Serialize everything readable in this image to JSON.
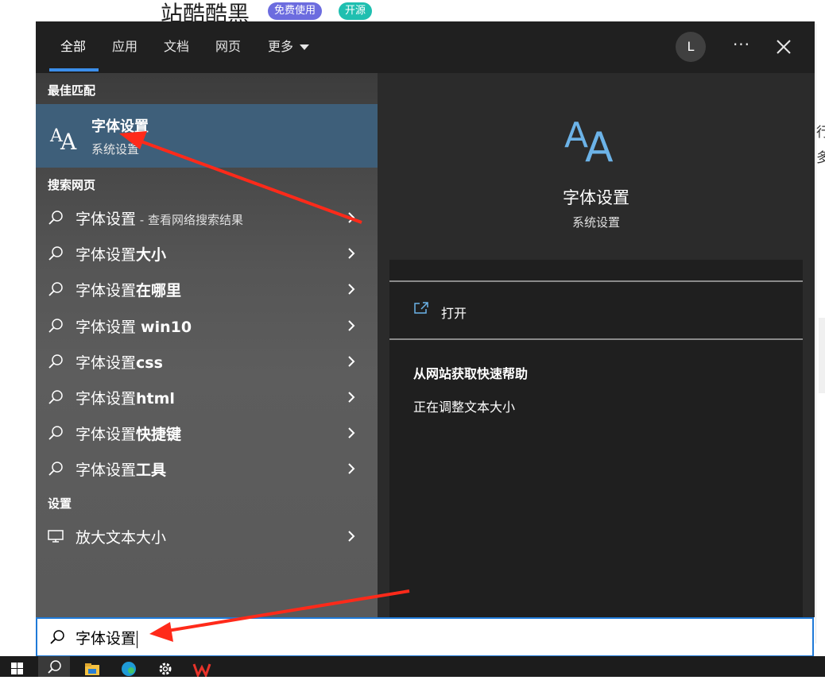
{
  "background_page": {
    "title": "站酷酷黑",
    "badge_free": "免费使用",
    "badge_open": "开源",
    "side_fragment_1": "行",
    "side_fragment_2": "多"
  },
  "tabs": [
    {
      "label": "全部",
      "active": true
    },
    {
      "label": "应用"
    },
    {
      "label": "文档"
    },
    {
      "label": "网页"
    },
    {
      "label": "更多"
    }
  ],
  "user": {
    "avatar_letter": "L"
  },
  "more_options": "···",
  "best_match": {
    "header": "最佳匹配",
    "title": "字体设置",
    "subtitle": "系统设置"
  },
  "web_search": {
    "header": "搜索网页",
    "items": [
      {
        "prefix": "字体设置",
        "bold": "",
        "suffix": " - 查看网络搜索结果"
      },
      {
        "prefix": "字体设置",
        "bold": "大小",
        "suffix": ""
      },
      {
        "prefix": "字体设置",
        "bold": "在哪里",
        "suffix": ""
      },
      {
        "prefix": "字体设置 ",
        "bold": "win10",
        "suffix": ""
      },
      {
        "prefix": "字体设置",
        "bold": "css",
        "suffix": ""
      },
      {
        "prefix": "字体设置",
        "bold": "html",
        "suffix": ""
      },
      {
        "prefix": "字体设置",
        "bold": "快捷键",
        "suffix": ""
      },
      {
        "prefix": "字体设置",
        "bold": "工具",
        "suffix": ""
      }
    ]
  },
  "settings": {
    "header": "设置",
    "items": [
      {
        "label": "放大文本大小"
      }
    ]
  },
  "detail": {
    "title": "字体设置",
    "subtitle": "系统设置",
    "open_label": "打开",
    "help_header": "从网站获取快速帮助",
    "help_link": "正在调整文本大小"
  },
  "search": {
    "value": "字体设置"
  },
  "colors": {
    "accent": "#3b8eea",
    "selected_bg": "#3e5f7a",
    "annotation_arrow": "#ff2a1a",
    "icon_blue": "#6cb3e8"
  }
}
